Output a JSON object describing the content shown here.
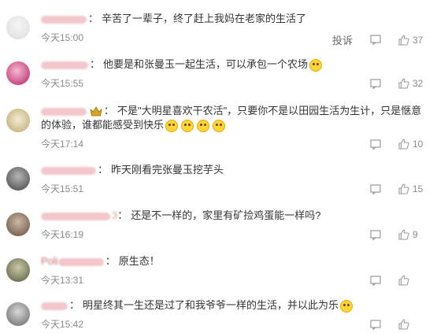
{
  "report_label": "投诉",
  "comments": [
    {
      "name_fragment": "",
      "text": "辛苦了一辈子，终了赶上我妈在老家的生活了",
      "time": "今天15:00",
      "likes": "37",
      "emojis": []
    },
    {
      "name_fragment": "",
      "text": "他要是和张曼玉一起生活，可以承包一个农场",
      "time": "今天15:55",
      "likes": "32",
      "emojis": [
        "laughing-emoji"
      ]
    },
    {
      "name_fragment": "",
      "text": "不是\"大明星喜欢干农活\"，只要你不是以田园生活为生计，只是惬意的体验，谁都能感受到快乐",
      "time": "今天17:14",
      "likes": "10",
      "emojis": [
        "emoji",
        "emoji",
        "emoji",
        "emoji"
      ]
    },
    {
      "name_fragment": "",
      "text": "昨天刚看完张曼玉挖芋头",
      "time": "今天15:51",
      "likes": "15",
      "emojis": []
    },
    {
      "name_fragment": "3",
      "text": "还是不一样的，家里有矿捡鸡蛋能一样吗?",
      "time": "今天16:19",
      "likes": "9",
      "emojis": []
    },
    {
      "name_fragment": "Poli",
      "text": "原生态！",
      "time": "今天13:31",
      "likes": "",
      "emojis": []
    },
    {
      "name_fragment": "",
      "text": "明星终其一生还是过了和我爷爷一样的生活，并以此为乐",
      "time": "今天15:42",
      "likes": "",
      "emojis": [
        "tearful-emoji"
      ]
    }
  ],
  "colors": {
    "text": "#333333",
    "meta": "#8a8a8a",
    "name_blur": "#f3c7cb",
    "emoji": "#ffd53a"
  }
}
